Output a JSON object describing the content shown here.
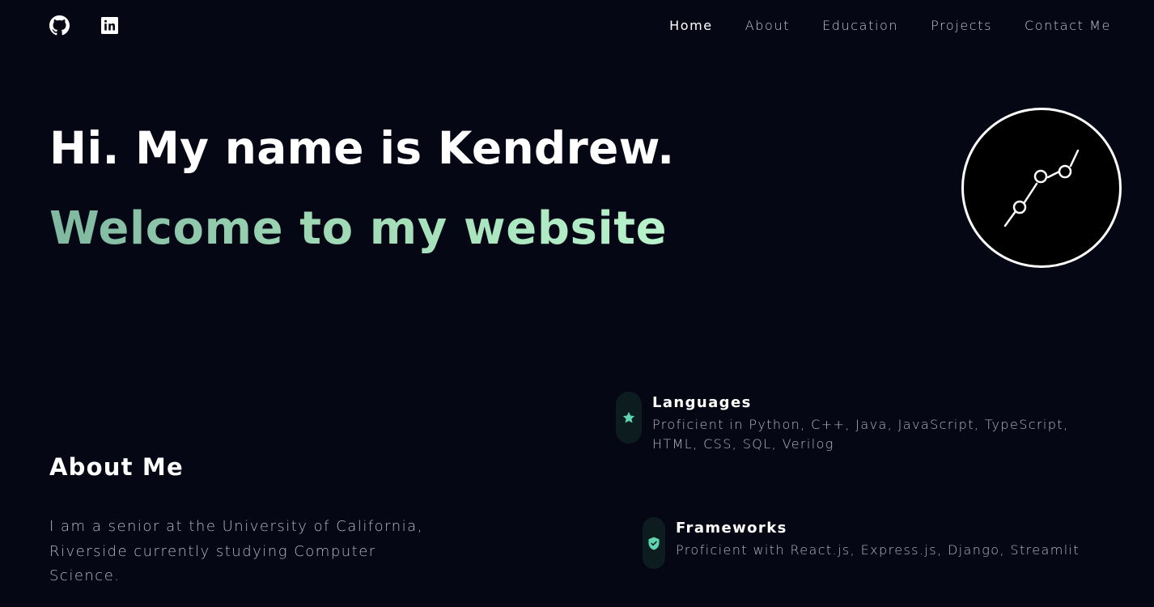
{
  "header": {
    "social": [
      {
        "icon": "github-icon",
        "label": "GitHub"
      },
      {
        "icon": "linkedin-icon",
        "label": "LinkedIn"
      }
    ],
    "nav": [
      {
        "label": "Home",
        "active": true
      },
      {
        "label": "About",
        "active": false
      },
      {
        "label": "Education",
        "active": false
      },
      {
        "label": "Projects",
        "active": false
      },
      {
        "label": "Contact Me",
        "active": false
      }
    ]
  },
  "hero": {
    "title": "Hi. My name is Kendrew.",
    "subtitle": "Welcome to my website",
    "logo_icon": "line-chart-logo-icon"
  },
  "about": {
    "title": "About Me",
    "text": "I am a senior at the University of California, Riverside currently studying Computer Science."
  },
  "skills": [
    {
      "icon": "star-icon",
      "name": "Languages",
      "description": "Proficient in Python, C++, Java, JavaScript, TypeScript, HTML, CSS, SQL, Verilog"
    },
    {
      "icon": "shield-check-icon",
      "name": "Frameworks",
      "description": "Proficient with React.js, Express.js, Django, Streamlit"
    }
  ],
  "colors": {
    "background": "#050814",
    "text_primary": "#ffffff",
    "text_secondary": "#b5b9c2",
    "accent_gradient_start": "#7fb7a0",
    "accent_gradient_end": "#b9f3cc",
    "icon_accent": "#5fd4b0",
    "pill_bg": "#0d1d1f"
  }
}
